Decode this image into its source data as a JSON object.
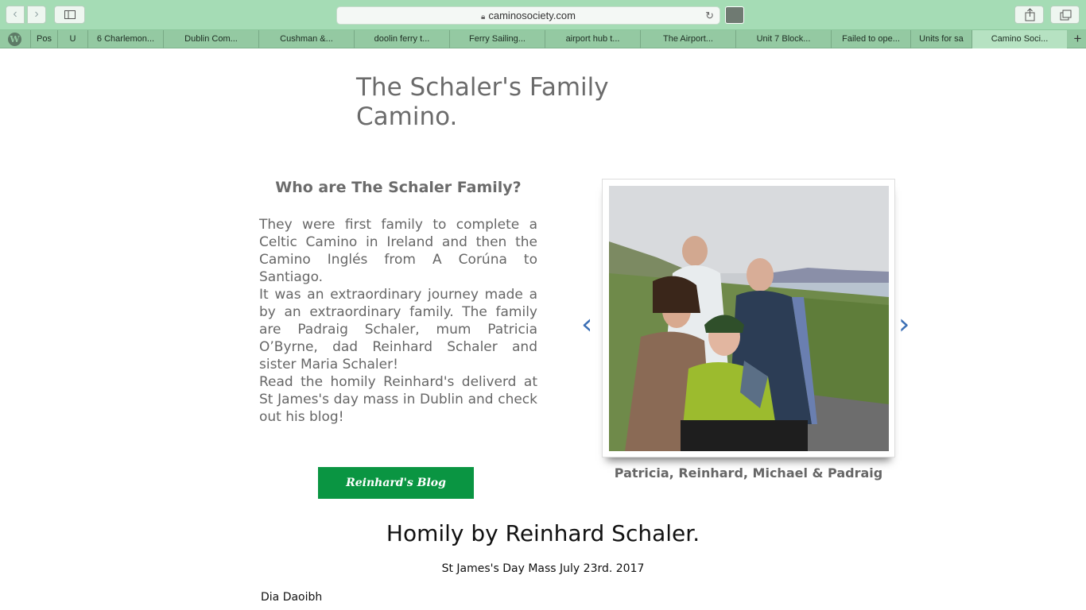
{
  "browser": {
    "url": "caminosociety.com",
    "tabs": [
      {
        "label": "Pos",
        "active": false
      },
      {
        "label": "U",
        "active": false
      },
      {
        "label": "6 Charlemon...",
        "active": false
      },
      {
        "label": "Dublin Com...",
        "active": false
      },
      {
        "label": "Cushman &...",
        "active": false
      },
      {
        "label": "doolin ferry t...",
        "active": false
      },
      {
        "label": "Ferry Sailing...",
        "active": false
      },
      {
        "label": "airport hub t...",
        "active": false
      },
      {
        "label": "The Airport...",
        "active": false
      },
      {
        "label": "Unit 7 Block...",
        "active": false
      },
      {
        "label": "Failed to ope...",
        "active": false
      },
      {
        "label": "Units for sa",
        "active": false
      },
      {
        "label": "Camino Soci...",
        "active": true
      }
    ],
    "new_tab": "+"
  },
  "page": {
    "title": "The Schaler's Family Camino.",
    "subtitle": "Who are The Schaler Family?",
    "paragraphs": [
      "They were first family to complete a Celtic Camino in Ireland and then the Camino Inglés from A Corúna to Santiago.",
      "It was an extraordinary journey made a by an extraordinary family. The family are Padraig Schaler, mum Patricia O’Byrne, dad Reinhard Schaler and sister Maria Schaler!",
      "Read the homily Reinhard's deliverd at St James's day mass in Dublin and check out his blog!"
    ],
    "blog_button": "Reinhard's Blog",
    "gallery": {
      "caption": "Patricia, Reinhard, Michael & Padraig",
      "prev": "‹",
      "next": "›"
    },
    "homily_title": "Homily by Reinhard Schaler.",
    "mass_line": "St James's Day Mass July 23rd. 2017",
    "greeting": "Dia Daoibh"
  },
  "colors": {
    "chrome": "#a5dcb5",
    "tabbar": "#94c9a2",
    "button_green": "#0a9542",
    "arrow_blue": "#3b6fb5"
  }
}
